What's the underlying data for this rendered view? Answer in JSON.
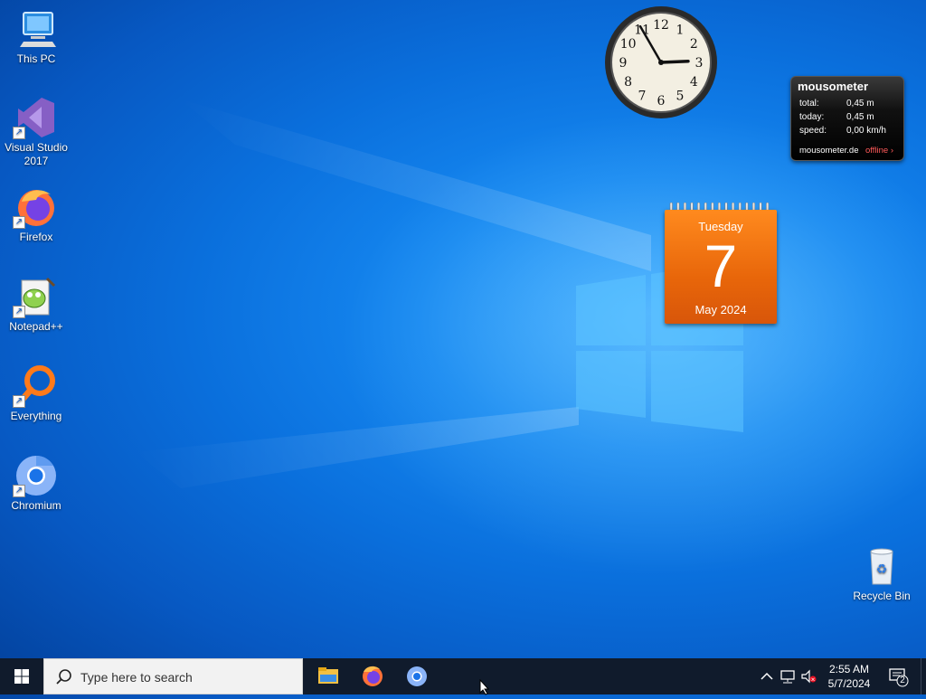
{
  "desktop": {
    "icons": [
      {
        "label": "This PC",
        "icon": "computer-icon"
      },
      {
        "label": "Visual Studio\n2017",
        "icon": "visual-studio-icon"
      },
      {
        "label": "Firefox",
        "icon": "firefox-icon"
      },
      {
        "label": "Notepad++",
        "icon": "notepad-plus-plus-icon"
      },
      {
        "label": "Everything",
        "icon": "everything-search-icon"
      },
      {
        "label": "Chromium",
        "icon": "chromium-icon"
      },
      {
        "label": "Recycle Bin",
        "icon": "recycle-bin-icon"
      }
    ]
  },
  "clock_gadget": {
    "numerals": [
      "12",
      "1",
      "2",
      "3",
      "4",
      "5",
      "6",
      "7",
      "8",
      "9",
      "10",
      "11"
    ],
    "time": {
      "hour": 2,
      "minute": 55
    }
  },
  "mousometer": {
    "title": "mousometer",
    "total_label": "total:",
    "total_value": "0,45 m",
    "today_label": "today:",
    "today_value": "0,45 m",
    "speed_label": "speed:",
    "speed_value": "0,00 km/h",
    "site": "mousometer.de",
    "status": "offline ›"
  },
  "calendar_gadget": {
    "weekday": "Tuesday",
    "day": "7",
    "month_year": "May 2024",
    "color": "#e8660a"
  },
  "taskbar": {
    "search_placeholder": "Type here to search",
    "pinned": [
      {
        "icon": "file-explorer-icon"
      },
      {
        "icon": "firefox-icon"
      },
      {
        "icon": "chromium-icon"
      }
    ],
    "clock_time": "2:55 AM",
    "clock_date": "5/7/2024",
    "notification_count": "2",
    "background": "#101b2c"
  }
}
